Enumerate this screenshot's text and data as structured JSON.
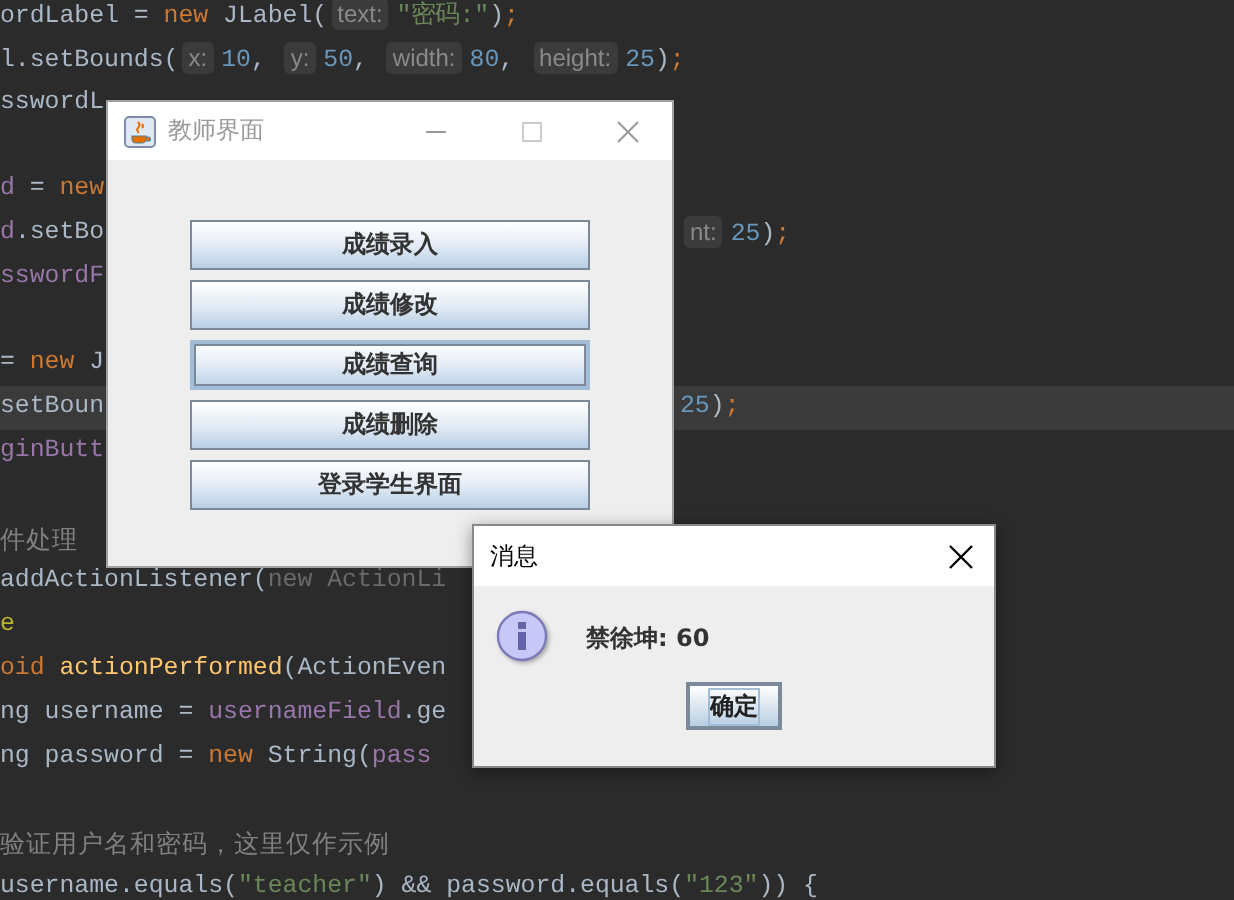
{
  "editor": {
    "lines": [
      {
        "tokens": [
          {
            "t": "ordLabel = ",
            "kind": "plain"
          },
          {
            "t": "new",
            "kind": "kw"
          },
          {
            "t": " JLabel(",
            "kind": "plain"
          },
          {
            "t": "text:",
            "kind": "hint"
          },
          {
            "t": "\"密码:\"",
            "kind": "str"
          },
          {
            "t": ")",
            "kind": "plain"
          },
          {
            "t": ";",
            "kind": "kw"
          }
        ]
      },
      {
        "tokens": [
          {
            "t": "l.setBounds(",
            "kind": "plain"
          },
          {
            "t": "x:",
            "kind": "hint"
          },
          {
            "t": "10",
            "kind": "num"
          },
          {
            "t": ", ",
            "kind": "plain"
          },
          {
            "t": "y:",
            "kind": "hint"
          },
          {
            "t": "50",
            "kind": "num"
          },
          {
            "t": ", ",
            "kind": "plain"
          },
          {
            "t": "width:",
            "kind": "hint"
          },
          {
            "t": "80",
            "kind": "num"
          },
          {
            "t": ", ",
            "kind": "plain"
          },
          {
            "t": "height:",
            "kind": "hint"
          },
          {
            "t": "25",
            "kind": "num"
          },
          {
            "t": ")",
            "kind": "plain"
          },
          {
            "t": ";",
            "kind": "kw"
          }
        ]
      },
      {
        "tokens": [
          {
            "t": "sswordL",
            "kind": "plain"
          }
        ],
        "blank_after": true
      },
      {
        "tokens": [
          {
            "t": "d",
            "kind": "field"
          },
          {
            "t": " = ",
            "kind": "plain"
          },
          {
            "t": "new",
            "kind": "kw"
          }
        ]
      },
      {
        "tokens": [
          {
            "t": "d",
            "kind": "field"
          },
          {
            "t": ".setBo",
            "kind": "plain"
          }
        ],
        "right": [
          {
            "t": "nt:",
            "kind": "hint"
          },
          {
            "t": "25",
            "kind": "num"
          },
          {
            "t": ")",
            "kind": "plain"
          },
          {
            "t": ";",
            "kind": "kw"
          }
        ]
      },
      {
        "tokens": [
          {
            "t": "sswordF",
            "kind": "field"
          }
        ],
        "blank_after": true
      },
      {
        "tokens": [
          {
            "t": "= ",
            "kind": "plain"
          },
          {
            "t": "new",
            "kind": "kw"
          },
          {
            "t": " J",
            "kind": "plain"
          }
        ]
      },
      {
        "tokens": [
          {
            "t": "setBoun",
            "kind": "plain"
          }
        ],
        "right": [
          {
            "t": "25",
            "kind": "num"
          },
          {
            "t": ")",
            "kind": "plain"
          },
          {
            "t": ";",
            "kind": "kw"
          }
        ],
        "current": true
      },
      {
        "tokens": [
          {
            "t": "ginButt",
            "kind": "field"
          }
        ],
        "blank_after": true
      },
      {
        "tokens": [
          {
            "t": "件处理",
            "kind": "comment"
          }
        ]
      },
      {
        "tokens": [
          {
            "t": "addActionListener(",
            "kind": "plain"
          },
          {
            "t": "new ActionLi",
            "kind": "dim"
          }
        ]
      },
      {
        "tokens": [
          {
            "t": "e",
            "kind": "annotation"
          }
        ]
      },
      {
        "tokens": [
          {
            "t": "oid ",
            "kind": "kw"
          },
          {
            "t": "actionPerformed",
            "kind": "method"
          },
          {
            "t": "(ActionEven",
            "kind": "plain"
          }
        ]
      },
      {
        "tokens": [
          {
            "t": "ng username = ",
            "kind": "plain"
          },
          {
            "t": "usernameField",
            "kind": "field"
          },
          {
            "t": ".ge",
            "kind": "plain"
          }
        ]
      },
      {
        "tokens": [
          {
            "t": "ng password = ",
            "kind": "plain"
          },
          {
            "t": "new",
            "kind": "kw"
          },
          {
            "t": " String(",
            "kind": "plain"
          },
          {
            "t": "pass",
            "kind": "field"
          }
        ],
        "blank_after": true
      },
      {
        "tokens": [
          {
            "t": "验证用户名和密码，这里仅作示例",
            "kind": "comment"
          }
        ]
      },
      {
        "tokens": [
          {
            "t": "username.equals(",
            "kind": "plain"
          },
          {
            "t": "\"teacher\"",
            "kind": "str"
          },
          {
            "t": ") && password.equals(",
            "kind": "plain"
          },
          {
            "t": "\"123\"",
            "kind": "str"
          },
          {
            "t": ")) {",
            "kind": "plain"
          }
        ]
      }
    ]
  },
  "teacher_window": {
    "title": "教师界面",
    "active": false,
    "buttons": [
      {
        "label": "成绩录入",
        "focused": false
      },
      {
        "label": "成绩修改",
        "focused": false
      },
      {
        "label": "成绩查询",
        "focused": true
      },
      {
        "label": "成绩删除",
        "focused": false
      },
      {
        "label": "登录学生界面",
        "focused": false
      }
    ]
  },
  "dialog": {
    "title": "消息",
    "active": true,
    "message": "禁徐坤: 60",
    "ok_button": {
      "label": "确定",
      "focused": true
    }
  }
}
